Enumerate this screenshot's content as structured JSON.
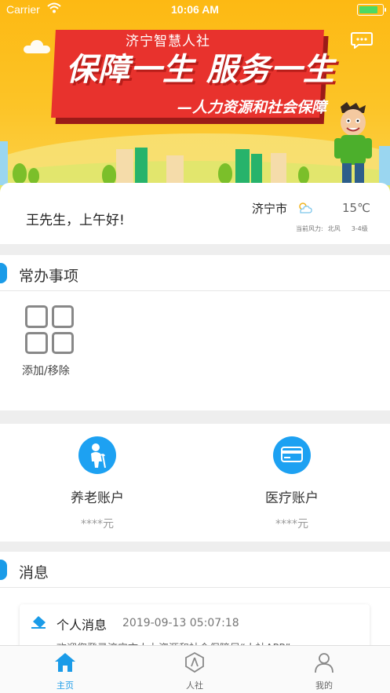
{
  "status_bar": {
    "carrier": "Carrier",
    "time": "10:06 AM",
    "battery_level": 0.85
  },
  "banner": {
    "org": "济宁智慧人社",
    "slogan": "保障一生  服务一生",
    "subtitle": "—人力资源和社会保障"
  },
  "greeting": {
    "text": "王先生，上午好!",
    "city": "济宁市",
    "temperature": "15℃",
    "wind_label": "当前风力:",
    "wind_dir": "北风",
    "wind_level": "3-4级",
    "weather_icon": "partly-cloudy-icon"
  },
  "changban": {
    "title": "常办事项",
    "add_label": "添加/移除"
  },
  "accounts": [
    {
      "name": "养老账户",
      "amount": "****元",
      "icon": "elderly-icon"
    },
    {
      "name": "医疗账户",
      "amount": "****元",
      "icon": "card-icon"
    }
  ],
  "messages": {
    "title": "消息",
    "item": {
      "title": "个人消息",
      "time": "2019-09-13 05:07:18",
      "body": "欢迎您登录济宁市人力资源和社会保障局“人社APP”"
    }
  },
  "tabbar": [
    {
      "label": "主页",
      "icon": "home-icon",
      "active": true
    },
    {
      "label": "人社",
      "icon": "shield-icon",
      "active": false
    },
    {
      "label": "我的",
      "icon": "person-icon",
      "active": false
    }
  ],
  "colors": {
    "accent": "#1a9be8",
    "banner": "#fdb913",
    "board": "#e8322d"
  }
}
